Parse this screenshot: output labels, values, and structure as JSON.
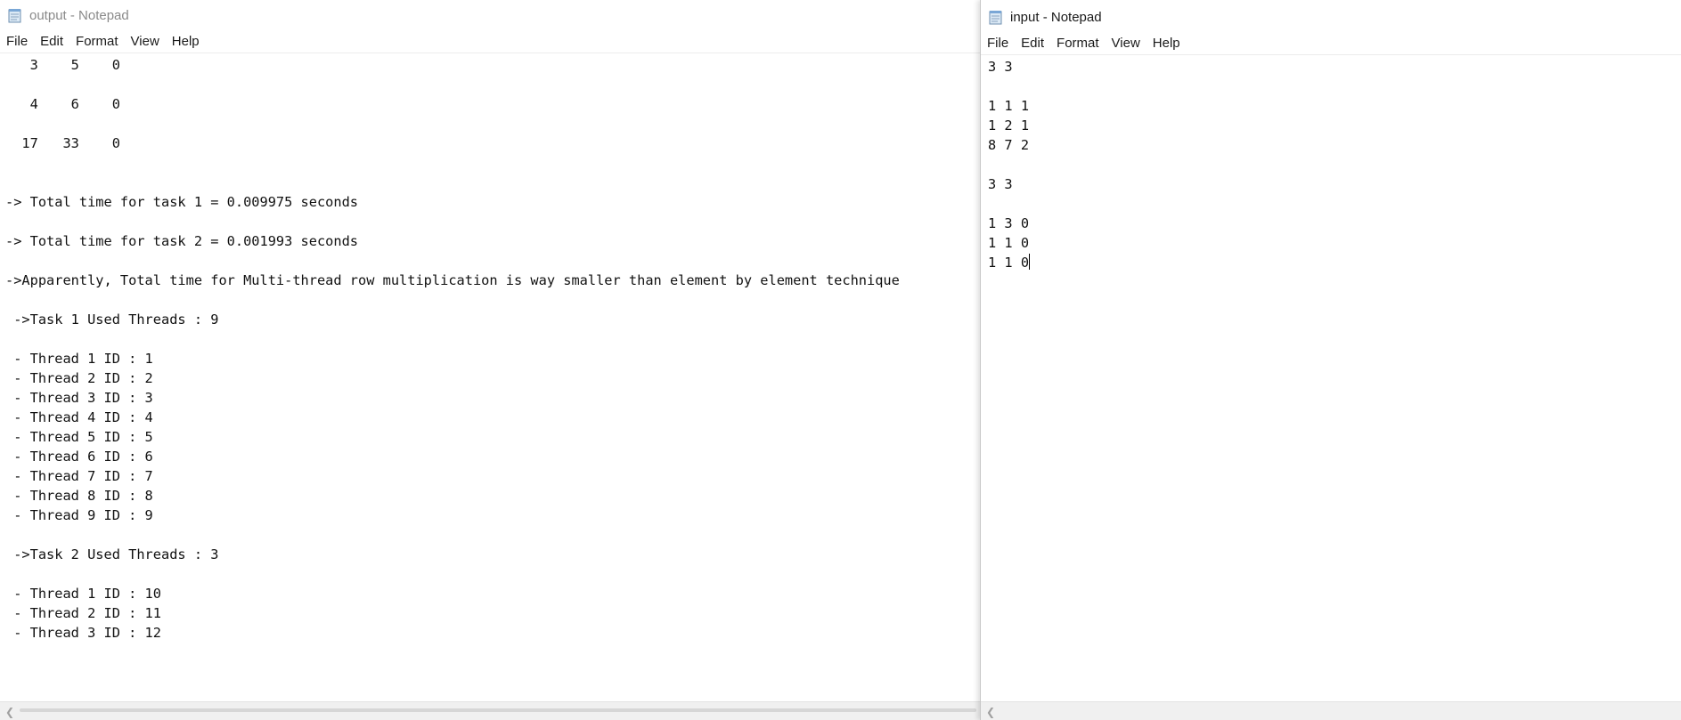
{
  "output_window": {
    "title": "output - Notepad",
    "menu": [
      "File",
      "Edit",
      "Format",
      "View",
      "Help"
    ],
    "lines": [
      "   3    5    0",
      "",
      "   4    6    0",
      "",
      "  17   33    0",
      "",
      "",
      "-> Total time for task 1 = 0.009975 seconds",
      "",
      "-> Total time for task 2 = 0.001993 seconds",
      "",
      "->Apparently, Total time for Multi-thread row multiplication is way smaller than element by element technique",
      "",
      " ->Task 1 Used Threads : 9",
      "",
      " - Thread 1 ID : 1",
      " - Thread 2 ID : 2",
      " - Thread 3 ID : 3",
      " - Thread 4 ID : 4",
      " - Thread 5 ID : 5",
      " - Thread 6 ID : 6",
      " - Thread 7 ID : 7",
      " - Thread 8 ID : 8",
      " - Thread 9 ID : 9",
      "",
      " ->Task 2 Used Threads : 3",
      "",
      " - Thread 1 ID : 10",
      " - Thread 2 ID : 11",
      " - Thread 3 ID : 12"
    ]
  },
  "input_window": {
    "title": "input - Notepad",
    "menu": [
      "File",
      "Edit",
      "Format",
      "View",
      "Help"
    ],
    "lines": [
      "3 3",
      "",
      "1 1 1",
      "1 2 1",
      "8 7 2",
      "",
      "3 3",
      "",
      "1 3 0",
      "1 1 0",
      "1 1 0"
    ]
  },
  "icons": {
    "app": "notepad-icon",
    "scroll_left": "scroll-left-arrow-icon"
  }
}
